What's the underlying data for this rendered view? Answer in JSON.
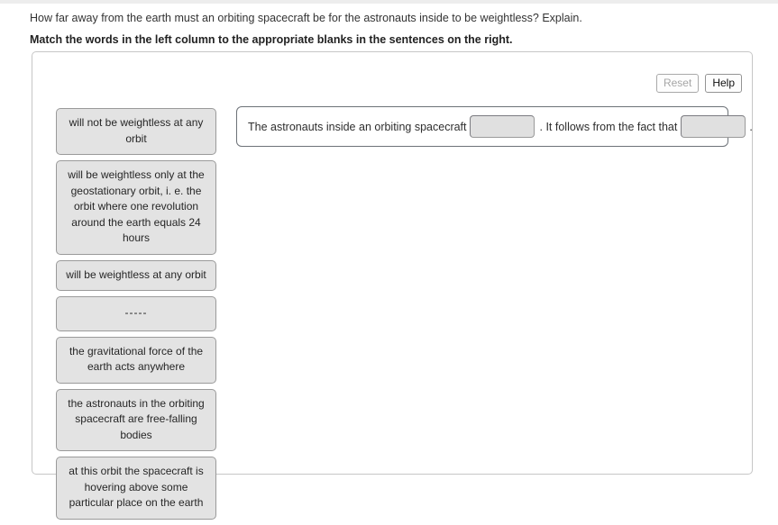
{
  "question": "How far away from the earth must an orbiting spacecraft be for the astronauts inside to be weightless? Explain.",
  "instruction": "Match the words in the left column to the appropriate blanks in the sentences on the right.",
  "toolbar": {
    "reset_label": "Reset",
    "help_label": "Help",
    "reset_disabled_color": "#a6a6a6",
    "help_color": "#111111"
  },
  "word_bank": {
    "items": [
      {
        "text": "will not be weightless at any orbit"
      },
      {
        "text": "will be weightless only at the geostationary orbit, i. e. the orbit where one revolution around the earth equals 24 hours"
      },
      {
        "text": "will be weightless at any orbit"
      },
      {
        "text": "-----"
      },
      {
        "text": "the gravitational force of the earth acts anywhere"
      },
      {
        "text": "the astronauts in the orbiting spacecraft are free-falling bodies"
      },
      {
        "text": "at this orbit the spacecraft is hovering above some particular place on the earth"
      }
    ]
  },
  "sentence": {
    "part1": "The astronauts inside an orbiting spacecraft",
    "blank1_value": "",
    "separator": ". It follows from the fact that",
    "blank2_value": "",
    "end_punctuation": "."
  },
  "colors": {
    "page_background": "#ffffff",
    "panel_border": "#c6c6c6",
    "bank_item_background": "#e3e3e3",
    "bank_item_border": "#9a9a9a",
    "blank_background": "#e0e0e0",
    "sentence_panel_border": "#6d7278"
  }
}
